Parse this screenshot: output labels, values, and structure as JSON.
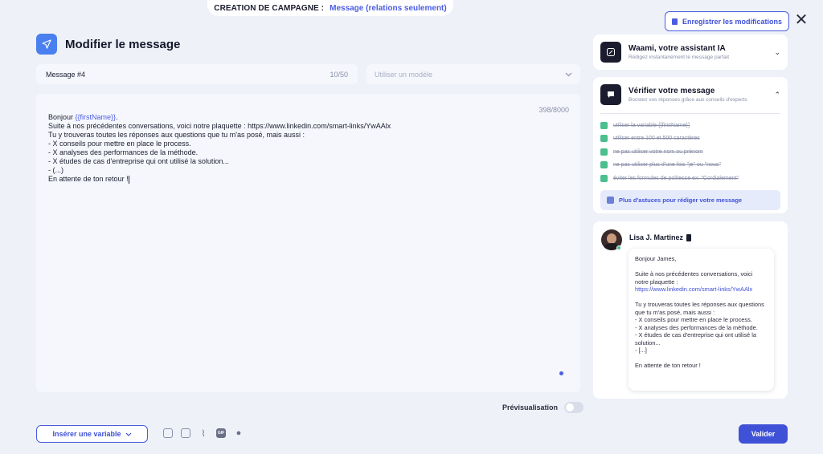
{
  "campaign": {
    "label": "CREATION DE CAMPAGNE :",
    "value": "Message (relations seulement)"
  },
  "header": {
    "save_label": "Enregistrer les modifications",
    "close_label": "✕",
    "title": "Modifier le message"
  },
  "message_name": {
    "value": "Message #4",
    "count": "10/50"
  },
  "template_select": {
    "placeholder": "Utiliser un modèle"
  },
  "editor": {
    "char_count": "398/8000",
    "greeting": "Bonjour ",
    "variable": "{{firstName}}",
    "greeting_end": ".",
    "lines": [
      "Suite à nos précédentes conversations, voici notre plaquette : https://www.linkedin.com/smart-links/YwAAlx",
      "Tu y trouveras toutes les réponses aux questions que tu m'as posé, mais aussi :",
      "- X conseils pour mettre en place le process.",
      "- X analyses des performances de la méthode.",
      "- X études de cas d'entreprise qui ont utilisé la solution...",
      "- (...)",
      "En attente de ton retour !"
    ]
  },
  "preview": {
    "label": "Prévisualisation",
    "enabled": false
  },
  "toolbar": {
    "insert_variable_label": "Insérer une variable",
    "gif_label": "GIF",
    "validate_label": "Valider"
  },
  "assistant": {
    "title": "Waami, votre assistant IA",
    "subtitle": "Rédigez instantanément le message parfait"
  },
  "verify": {
    "title": "Vérifier votre message",
    "subtitle": "Boostez vos réponses grâce aux conseils d'experts",
    "checks": [
      "utiliser la variable {{firstName}}",
      "utiliser entre 100 et 500 caractères",
      "ne pas utiliser votre nom ou prénom",
      "ne pas utiliser plus d'une fois \"je\" ou \"nous\"",
      "éviter les formules de politesse ex: \"Cordialement\""
    ],
    "tips_label": "Plus d'astuces pour rédiger votre message"
  },
  "chat": {
    "sender": "Lisa J. Martinez",
    "greeting": "Bonjour James,",
    "intro": "Suite à nos précédentes conversations, voici notre plaquette :",
    "link": "https://www.linkedin.com/smart-links/YwAAlx",
    "body": [
      "Tu y trouveras toutes les réponses aux questions que tu m'as posé, mais aussi :",
      "- X conseils pour mettre en place le process.",
      "- X analyses des performances de la méthode.",
      "- X études de cas d'entreprise qui ont utilisé la solution...",
      "- [...]"
    ],
    "closing": "En attente de ton retour !"
  },
  "colors": {
    "accent": "#3f51d6",
    "check": "#4bbf8e",
    "background": "#eef1f8"
  }
}
